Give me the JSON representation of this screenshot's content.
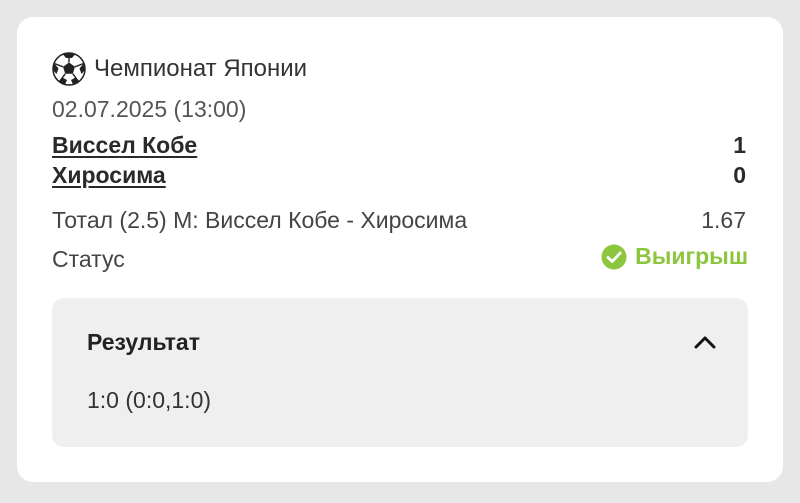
{
  "match": {
    "league": "Чемпионат Японии",
    "datetime": "02.07.2025 (13:00)",
    "team1": {
      "name": "Виссел Кобе",
      "score": "1"
    },
    "team2": {
      "name": "Хиросима",
      "score": "0"
    }
  },
  "bet": {
    "description": "Тотал (2.5) М: Виссел Кобе - Хиросима",
    "odds": "1.67",
    "status_label": "Статус",
    "status_value": "Выигрыш"
  },
  "result": {
    "title": "Результат",
    "score_detail": "1:0 (0:0,1:0)"
  },
  "colors": {
    "win": "#8cc63f",
    "background": "#e7e7e7",
    "card": "#ffffff",
    "panel": "#efefef"
  },
  "icons": {
    "league": "soccer-ball-icon",
    "status": "check-circle-icon",
    "collapse": "chevron-up-icon"
  }
}
